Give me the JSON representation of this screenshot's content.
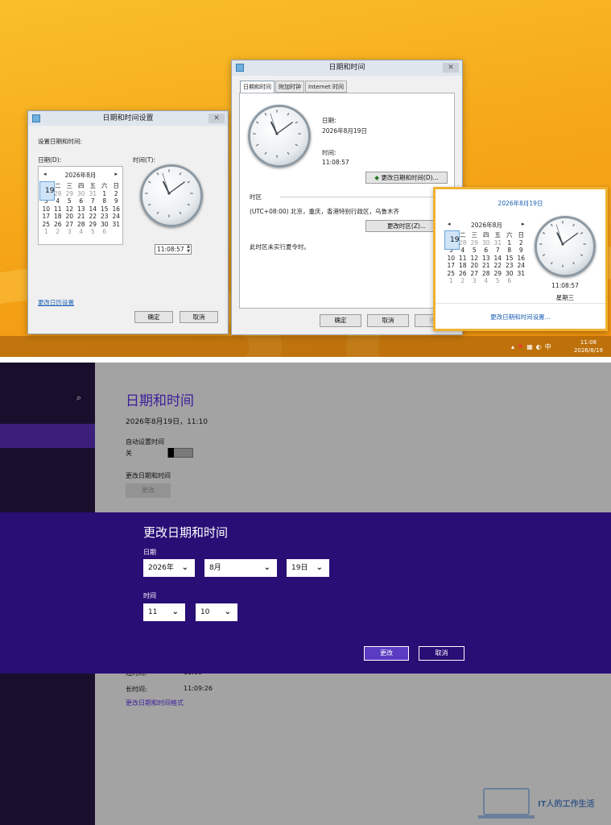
{
  "dialog_settings": {
    "title": "日期和时间设置",
    "subtitle": "设置日期和时间:",
    "date_label": "日期(D):",
    "time_label": "时间(T):",
    "calendar_month": "2026年8月",
    "weekdays": [
      "一",
      "二",
      "三",
      "四",
      "五",
      "六",
      "日"
    ],
    "days": [
      "27",
      "28",
      "29",
      "30",
      "31",
      "1",
      "2",
      "3",
      "4",
      "5",
      "6",
      "7",
      "8",
      "9",
      "10",
      "11",
      "12",
      "13",
      "14",
      "15",
      "16",
      "17",
      "18",
      "19",
      "20",
      "21",
      "22",
      "23",
      "24",
      "25",
      "26",
      "27",
      "28",
      "29",
      "30",
      "31",
      "1",
      "2",
      "3",
      "4",
      "5",
      "6"
    ],
    "time_value": "11:08:57",
    "calendar_settings_link": "更改日历设置",
    "ok": "确定",
    "cancel": "取消"
  },
  "dialog_main": {
    "title": "日期和时间",
    "tabs": [
      "日期和时间",
      "附加时钟",
      "Internet 时间"
    ],
    "date_label": "日期:",
    "date_value": "2026年8月19日",
    "time_label": "时间:",
    "time_value": "11:08:57",
    "change_datetime_button": "更改日期和时间(D)...",
    "timezone_header": "时区",
    "timezone_value": "(UTC+08:00) 北京，重庆，香港特别行政区，乌鲁木齐",
    "change_timezone_button": "更改时区(Z)...",
    "dst_note": "此时区未实行夏令时。",
    "ok": "确定",
    "cancel": "取消",
    "apply": "应用"
  },
  "flyout": {
    "header_date": "2026年8月19日",
    "calendar_month": "2026年8月",
    "weekdays": [
      "一",
      "二",
      "三",
      "四",
      "五",
      "六",
      "日"
    ],
    "days": [
      "27",
      "28",
      "29",
      "30",
      "31",
      "1",
      "2",
      "3",
      "4",
      "5",
      "6",
      "7",
      "8",
      "9",
      "10",
      "11",
      "12",
      "13",
      "14",
      "15",
      "16",
      "17",
      "18",
      "19",
      "20",
      "21",
      "22",
      "23",
      "24",
      "25",
      "26",
      "27",
      "28",
      "29",
      "30",
      "31",
      "1",
      "2",
      "3",
      "4",
      "5",
      "6"
    ],
    "time": "11:08:57",
    "weekday": "星期三",
    "settings_link": "更改日期和时间设置..."
  },
  "taskbar": {
    "clock_time": "11:08",
    "clock_date": "2026/8/19"
  },
  "modern": {
    "page_title": "日期和时间",
    "current_datetime": "2026年8月19日，11:10",
    "auto_set_label": "自动设置时间",
    "auto_set_state": "关",
    "change_label": "更改日期和时间",
    "change_button": "更改",
    "short_time_label": "短时间:",
    "short_time_value": "11:09",
    "long_time_label": "长时间:",
    "long_time_value": "11:09:26",
    "format_link": "更改日期和时间格式"
  },
  "change_panel": {
    "title": "更改日期和时间",
    "date_label": "日期",
    "year": "2026年",
    "month": "8月",
    "day": "19日",
    "time_label": "时间",
    "hour": "11",
    "minute": "10",
    "confirm": "更改",
    "cancel": "取消"
  },
  "watermark": {
    "text": "IT人的工作生活"
  },
  "colors": {
    "band": "#290e76",
    "link": "#1a5fb4",
    "title_purple": "#3b1f9a"
  }
}
